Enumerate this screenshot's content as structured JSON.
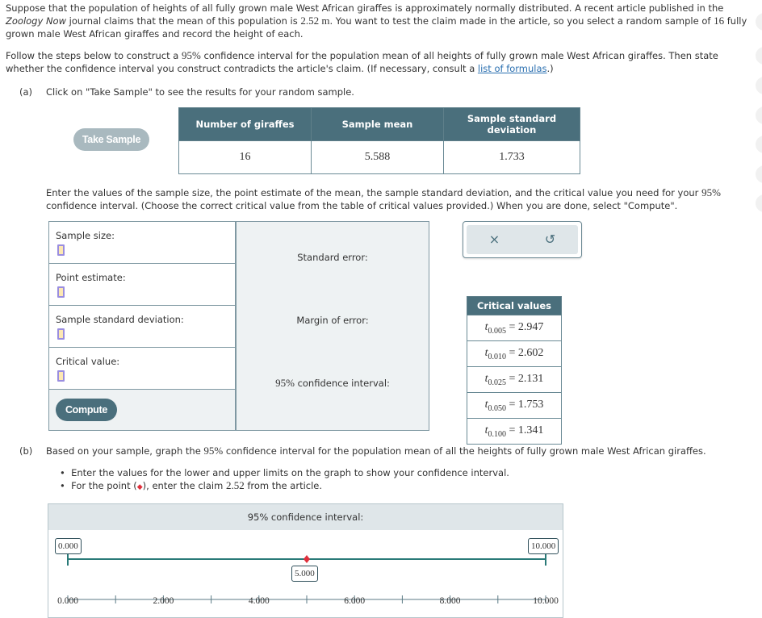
{
  "intro": {
    "line1": "Suppose that the population of heights of all fully grown male West African giraffes is approximately normally distributed. A recent article published in the",
    "journal": "Zoology Now",
    "line2a": " journal claims that the mean of this population is ",
    "claim_value": "2.52 m",
    "line2b": ". You want to test the claim made in the article, so you select a random sample of ",
    "sample_n": "16",
    "line2c": " fully",
    "line3": "grown male West African giraffes and record the height of each."
  },
  "instructions": {
    "a": "Follow the steps below to construct a ",
    "conf": "95%",
    "b": " confidence interval for the population mean of all heights of fully grown male West African giraffes. Then state",
    "c": "whether the confidence interval you construct contradicts the article's claim. (If necessary, consult a ",
    "link": "list of formulas",
    "d": ".)"
  },
  "part_a": {
    "marker": "(a)",
    "text": "Click on \"Take Sample\" to see the results for your random sample.",
    "take_sample_label": "Take Sample",
    "table": {
      "headers": [
        "Number of giraffes",
        "Sample mean",
        "Sample standard deviation"
      ],
      "values": [
        "16",
        "5.588",
        "1.733"
      ]
    },
    "enter_text_1a": "Enter the values of the sample size, the point estimate of the mean, the sample standard deviation, and the critical value you need for your ",
    "enter_conf": "95%",
    "enter_text_2": "confidence interval. (Choose the correct critical value from the table of critical values provided.) When you are done, select \"Compute\".",
    "inputs": [
      {
        "label": "Sample size:",
        "value": ""
      },
      {
        "label": "Point estimate:",
        "value": ""
      },
      {
        "label": "Sample standard deviation:",
        "value": ""
      },
      {
        "label": "Critical value:",
        "value": ""
      }
    ],
    "compute_label": "Compute",
    "outputs": {
      "standard_error": "Standard error:",
      "margin_of_error": "Margin of error:",
      "ci_conf": "95%",
      "ci_label": " confidence interval:"
    },
    "toolbar": {
      "clear_icon": "×",
      "undo_icon": "↺"
    },
    "critical_values": {
      "header": "Critical values",
      "rows": [
        {
          "sub": "0.005",
          "value": "2.947"
        },
        {
          "sub": "0.010",
          "value": "2.602"
        },
        {
          "sub": "0.025",
          "value": "2.131"
        },
        {
          "sub": "0.050",
          "value": "1.753"
        },
        {
          "sub": "0.100",
          "value": "1.341"
        }
      ]
    }
  },
  "part_b": {
    "marker": "(b)",
    "text_a": "Based on your sample, graph the ",
    "conf": "95%",
    "text_b": " confidence interval for the population mean of all the heights of fully grown male West African giraffes.",
    "bullets": {
      "b1": "Enter the values for the lower and upper limits on the graph to show your confidence interval.",
      "b2a": "For the point (",
      "b2_icon": "◆",
      "b2b": "), enter the claim ",
      "b2_claim": "2.52",
      "b2c": " from the article."
    },
    "graph": {
      "title": "95% confidence interval:",
      "lower": "0.000",
      "upper": "10.000",
      "point": "5.000",
      "lower_value": 0,
      "upper_value": 10,
      "point_value": 5,
      "axis_min": 0,
      "axis_max": 10,
      "major_ticks": [
        0,
        2,
        4,
        6,
        8,
        10
      ],
      "minor_ticks": [
        1,
        3,
        5,
        7,
        9
      ],
      "tick_labels": [
        "0.000",
        "2.000",
        "4.000",
        "6.000",
        "8.000",
        "10.000"
      ],
      "interval_color": "#2a7a78",
      "point_color": "#e0303c"
    }
  }
}
